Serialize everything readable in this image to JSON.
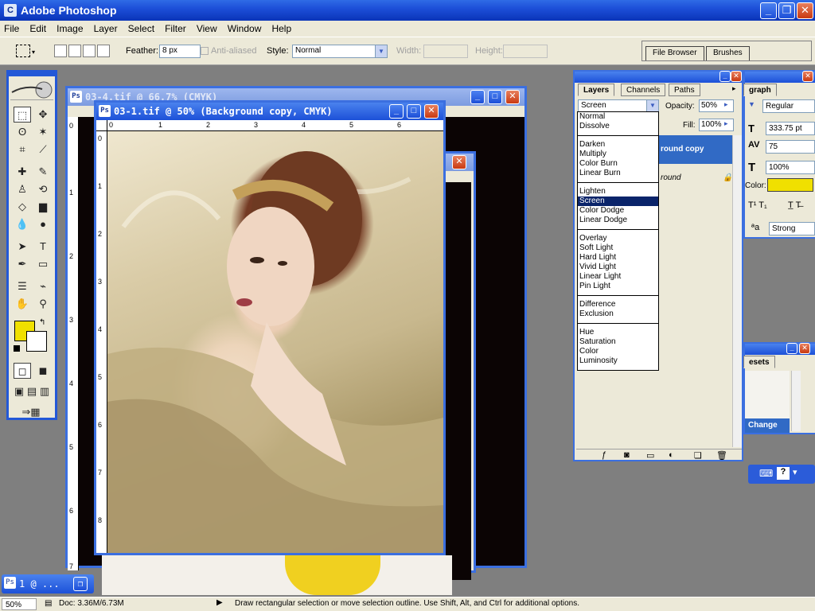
{
  "app": {
    "title": "Adobe Photoshop",
    "icon_label": "C"
  },
  "menu": [
    "File",
    "Edit",
    "Image",
    "Layer",
    "Select",
    "Filter",
    "View",
    "Window",
    "Help"
  ],
  "options_bar": {
    "feather_label": "Feather:",
    "feather_value": "8 px",
    "anti_aliased_label": "Anti-aliased",
    "style_label": "Style:",
    "style_value": "Normal",
    "width_label": "Width:",
    "height_label": "Height:"
  },
  "palette_well": {
    "tabs": [
      "File Browser",
      "Brushes"
    ]
  },
  "colors": {
    "foreground": "#f0e000",
    "background": "#ffffff",
    "accent": "#1c50d8",
    "selection": "#0a246a"
  },
  "documents": {
    "back": {
      "title": "03-4.tif @ 66.7% (CMYK)"
    },
    "front": {
      "title": "03-1.tif @ 50% (Background copy, CMYK)"
    },
    "minimized": {
      "title": "1 @ ..."
    },
    "front_ruler_h": [
      "0",
      "1",
      "2",
      "3",
      "4",
      "5",
      "6"
    ],
    "front_ruler_v": [
      "0",
      "1",
      "2",
      "3",
      "4",
      "5",
      "6",
      "7",
      "8"
    ],
    "back_ruler_v": [
      "0",
      "1",
      "2",
      "3",
      "4",
      "5",
      "6",
      "7"
    ]
  },
  "layers_panel": {
    "tabs": [
      "Layers",
      "Channels",
      "Paths"
    ],
    "blend_mode": "Screen",
    "opacity_label": "Opacity:",
    "opacity_value": "50%",
    "fill_label": "Fill:",
    "fill_value": "100%",
    "layer_top": "round copy",
    "layer_bottom": "round"
  },
  "blend_modes": [
    [
      "Normal",
      "Dissolve"
    ],
    [
      "Darken",
      "Multiply",
      "Color Burn",
      "Linear Burn"
    ],
    [
      "Lighten",
      "Screen",
      "Color Dodge",
      "Linear Dodge"
    ],
    [
      "Overlay",
      "Soft Light",
      "Hard Light",
      "Vivid Light",
      "Linear Light",
      "Pin Light"
    ],
    [
      "Difference",
      "Exclusion"
    ],
    [
      "Hue",
      "Saturation",
      "Color",
      "Luminosity"
    ]
  ],
  "blend_selected": "Screen",
  "character_panel": {
    "tab": "graph",
    "font_style": "Regular",
    "size_value": "333.75 pt",
    "leading_value": "75",
    "scale_value": "100%",
    "color_label": "Color:",
    "antialias_value": "Strong"
  },
  "presets_panel": {
    "tab": "esets",
    "button": "Change"
  },
  "status_bar": {
    "zoom": "50%",
    "doc": "Doc: 3.36M/6.73M",
    "hint": "Draw rectangular selection or move selection outline.  Use Shift, Alt, and Ctrl for additional options."
  }
}
